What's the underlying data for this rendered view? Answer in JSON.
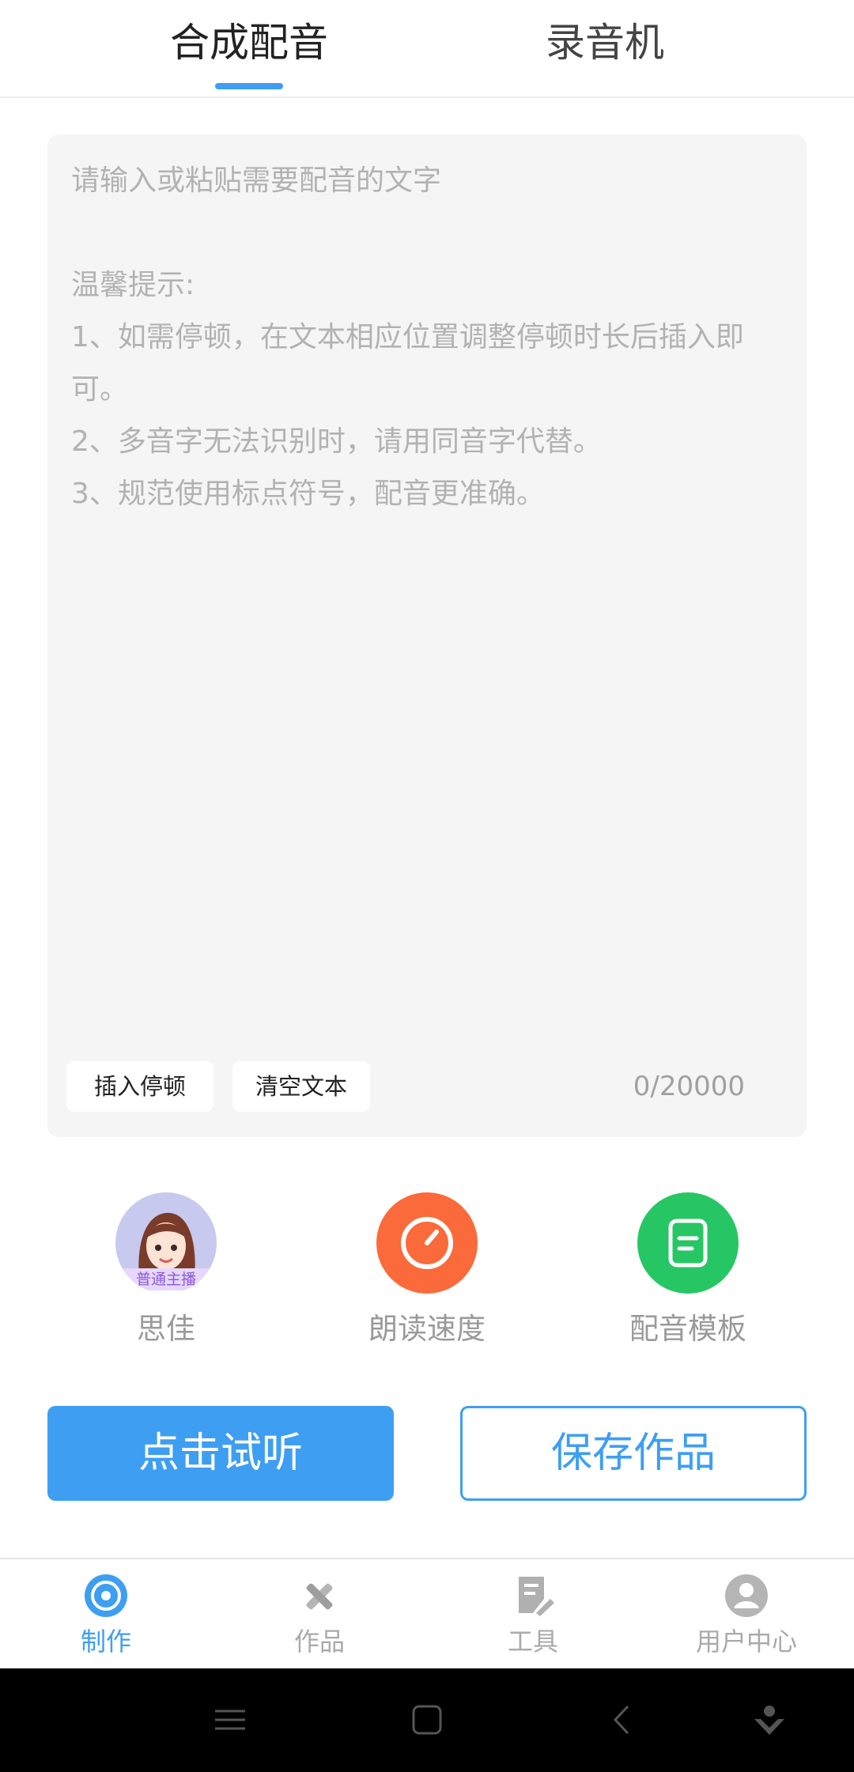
{
  "top_tabs": {
    "tab1": "合成配音",
    "tab2": "录音机"
  },
  "editor": {
    "placeholder": "请输入或粘贴需要配音的文字\n\n温馨提示:\n1、如需停顿，在文本相应位置调整停顿时长后插入即可。\n2、多音字无法识别时，请用同音字代替。\n3、规范使用标点符号，配音更准确。",
    "insert_pause": "插入停顿",
    "clear_text": "清空文本",
    "counter": "0/20000"
  },
  "features": {
    "voice_badge": "普通主播",
    "voice_name": "思佳",
    "speed_label": "朗读速度",
    "template_label": "配音模板"
  },
  "actions": {
    "listen": "点击试听",
    "save": "保存作品"
  },
  "bottom_nav": {
    "make": "制作",
    "works": "作品",
    "tools": "工具",
    "user": "用户中心"
  },
  "colors": {
    "accent": "#3e9ef2",
    "speed": "#fb6a3a",
    "template": "#27c664"
  }
}
